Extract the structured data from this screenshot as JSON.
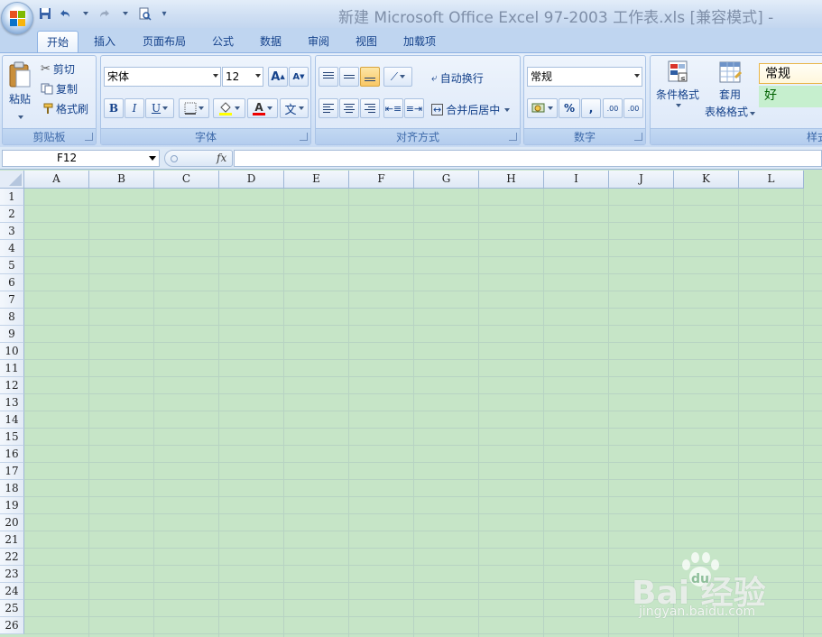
{
  "window": {
    "title": "新建 Microsoft Office Excel 97-2003 工作表.xls  [兼容模式] -"
  },
  "qat": {
    "icons": [
      "save-icon",
      "undo-icon",
      "redo-icon",
      "print-preview-icon",
      "customize-qat-icon"
    ]
  },
  "tabs": [
    {
      "label": "开始",
      "active": true
    },
    {
      "label": "插入"
    },
    {
      "label": "页面布局"
    },
    {
      "label": "公式"
    },
    {
      "label": "数据"
    },
    {
      "label": "审阅"
    },
    {
      "label": "视图"
    },
    {
      "label": "加载项"
    }
  ],
  "ribbon": {
    "clipboard": {
      "label": "剪贴板",
      "paste": "粘贴",
      "cut": "剪切",
      "copy": "复制",
      "format_painter": "格式刷"
    },
    "font": {
      "label": "字体",
      "font_name": "宋体",
      "font_size": "12",
      "grow_font": "A",
      "shrink_font": "A",
      "bold": "B",
      "italic": "I",
      "underline": "U",
      "font_color": "A",
      "phonetic": "文"
    },
    "alignment": {
      "label": "对齐方式",
      "wrap_text": "自动换行",
      "merge_center": "合并后居中"
    },
    "number": {
      "label": "数字",
      "format": "常规",
      "percent": "%",
      "comma": ",",
      "increase_decimal": ".00",
      "decrease_decimal": ".00"
    },
    "styles": {
      "label": "样式",
      "conditional_format": "条件格式",
      "table_format_line1": "套用",
      "table_format_line2": "表格格式",
      "style_normal": "常规",
      "style_good": "好"
    }
  },
  "formula_bar": {
    "name_box": "F12",
    "fx": "fx",
    "value": ""
  },
  "grid": {
    "columns": [
      "A",
      "B",
      "C",
      "D",
      "E",
      "F",
      "G",
      "H",
      "I",
      "J",
      "K",
      "L"
    ],
    "rows": [
      "1",
      "2",
      "3",
      "4",
      "5",
      "6",
      "7",
      "8",
      "9",
      "10",
      "11",
      "12",
      "13",
      "14",
      "15",
      "16",
      "17",
      "18",
      "19",
      "20",
      "21",
      "22",
      "23",
      "24",
      "25",
      "26"
    ]
  },
  "watermark": {
    "main": "Bai  经验",
    "du": "du",
    "sub": "jingyan.baidu.com"
  },
  "colors": {
    "sheet_background": "#c6e5c7",
    "ribbon": "#dbe7f8",
    "accent": "#15428b"
  }
}
